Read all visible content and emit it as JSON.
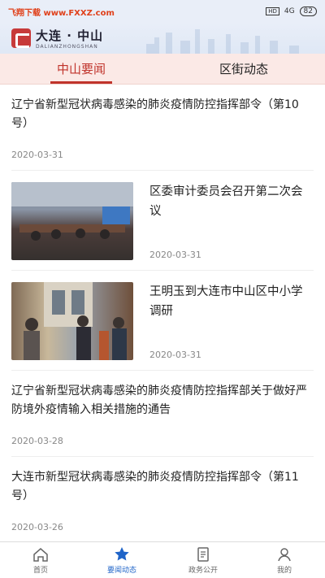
{
  "status_bar": {
    "watermark": "飞翔下载 www.FXXZ.com",
    "signal": "HD",
    "network": "4G",
    "battery": "82"
  },
  "header": {
    "title": "大连 · 中山",
    "subtitle": "DALIANZHONGSHAN"
  },
  "tabs": [
    {
      "label": "中山要闻",
      "active": true
    },
    {
      "label": "区街动态",
      "active": false
    }
  ],
  "articles": [
    {
      "title": "辽宁省新型冠状病毒感染的肺炎疫情防控指挥部令（第10号）",
      "date": "2020-03-31"
    },
    {
      "title": "区委审计委员会召开第二次会议",
      "date": "2020-03-31"
    },
    {
      "title": "王明玉到大连市中山区中小学调研",
      "date": "2020-03-31"
    },
    {
      "title": "辽宁省新型冠状病毒感染的肺炎疫情防控指挥部关于做好严防境外疫情输入相关措施的通告",
      "date": "2020-03-28"
    },
    {
      "title": "大连市新型冠状病毒感染的肺炎疫情防控指挥部令（第11号）",
      "date": "2020-03-26"
    }
  ],
  "bottom_nav": [
    {
      "label": "首页",
      "icon": "home-icon"
    },
    {
      "label": "要闻动态",
      "icon": "star-icon",
      "active": true
    },
    {
      "label": "政务公开",
      "icon": "document-icon"
    },
    {
      "label": "我的",
      "icon": "user-icon"
    }
  ]
}
